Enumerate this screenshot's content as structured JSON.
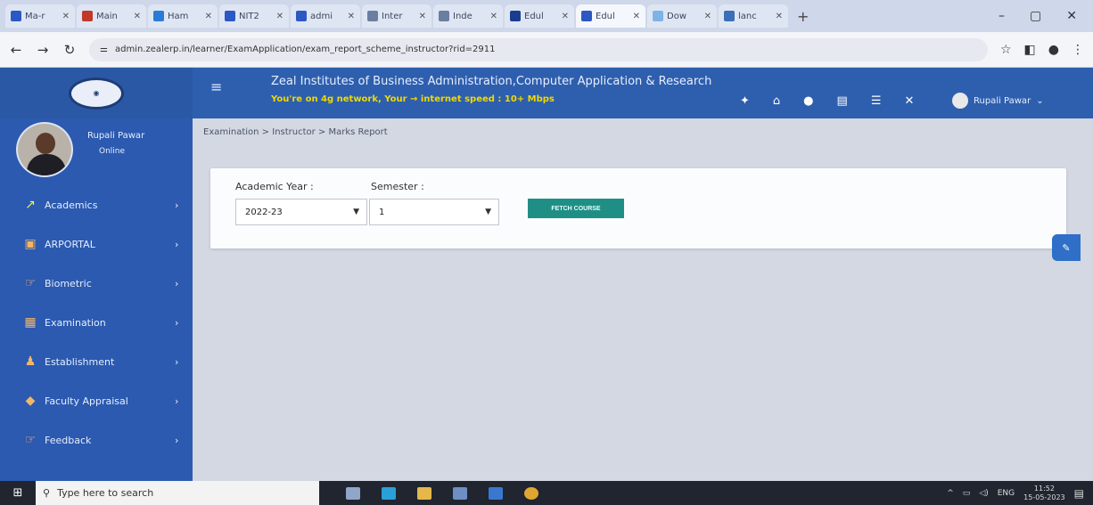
{
  "browser": {
    "tabs": [
      {
        "label": "Ma-r"
      },
      {
        "label": "Main"
      },
      {
        "label": "Ham"
      },
      {
        "label": "NIT2"
      },
      {
        "label": "admi"
      },
      {
        "label": "Inter"
      },
      {
        "label": "Inde"
      },
      {
        "label": "Edul"
      },
      {
        "label": "Edul",
        "active": true
      },
      {
        "label": "Dow"
      },
      {
        "label": "lanc"
      }
    ],
    "url": "admin.zealerp.in/learner/ExamApplication/exam_report_scheme_instructor?rid=2911"
  },
  "header": {
    "institute_name": "Zeal Institutes of Business Administration,Computer Application & Research",
    "network_message": "You're on 4g network, Your  → internet speed : 10+ Mbps",
    "user_name": "Rupali Pawar"
  },
  "sidebar": {
    "profile_name": "Rupali Pawar",
    "profile_status": "Online",
    "items": [
      {
        "label": "Academics",
        "icon": "chart-icon"
      },
      {
        "label": "ARPORTAL",
        "icon": "portal-icon"
      },
      {
        "label": "Biometric",
        "icon": "fingerprint-icon"
      },
      {
        "label": "Examination",
        "icon": "exam-icon"
      },
      {
        "label": "Establishment",
        "icon": "establishment-icon"
      },
      {
        "label": "Faculty Appraisal",
        "icon": "appraisal-icon"
      },
      {
        "label": "Feedback",
        "icon": "feedback-icon"
      }
    ]
  },
  "main": {
    "breadcrumb": "Examination > Instructor > Marks Report",
    "academic_year_label": "Academic Year :",
    "academic_year_value": "2022-23",
    "semester_label": "Semester :",
    "semester_value": "1",
    "fetch_button": "FETCH COURSE"
  },
  "taskbar": {
    "search_placeholder": "Type here to search",
    "lang": "ENG",
    "time": "11:52",
    "date": "15-05-2023"
  },
  "colors": {
    "header_blue": "#2e5fae",
    "sidebar_blue": "#2b5ab0",
    "fetch_button": "#1f8f86",
    "network_text": "#f0d800"
  }
}
